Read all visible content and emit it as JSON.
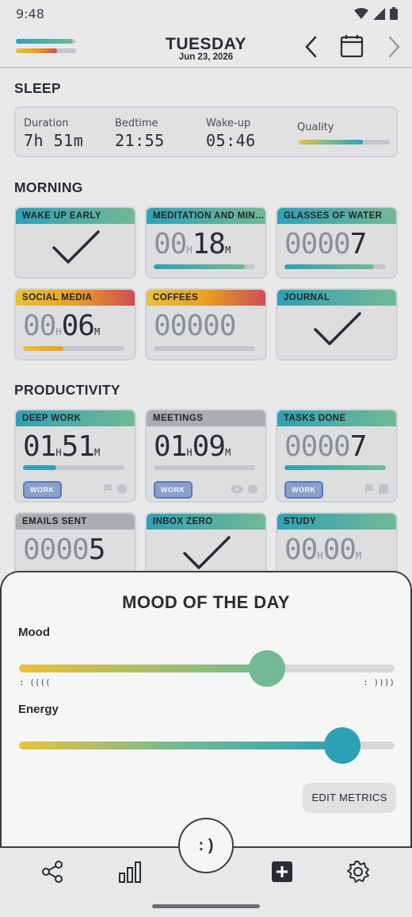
{
  "status": {
    "time": "9:48"
  },
  "header": {
    "day": "TUESDAY",
    "date": "Jun 23, 2026",
    "bar1_fill": 0.95,
    "bar2_fill": 0.68
  },
  "sleep": {
    "title": "SLEEP",
    "duration_label": "Duration",
    "duration_value": "7h 51m",
    "bedtime_label": "Bedtime",
    "bedtime_value": "21:55",
    "wakeup_label": "Wake-up",
    "wakeup_value": "05:46",
    "quality_label": "Quality",
    "quality_fill": 0.7
  },
  "morning": {
    "title": "MORNING",
    "tiles": [
      {
        "label": "WAKE UP EARLY",
        "kind": "check"
      },
      {
        "label": "MEDITATION AND MINDFULNESS",
        "hours": "00",
        "hours_unit": "H",
        "minutes": "18",
        "minutes_unit": "M",
        "fill": 0.9
      },
      {
        "label": "GLASSES OF WATER",
        "count_dim": "0000",
        "count": "7",
        "fill": 0.88
      },
      {
        "label": "SOCIAL MEDIA",
        "hours": "00",
        "hours_unit": "H",
        "minutes": "06",
        "minutes_unit": "M",
        "fill": 0.4
      },
      {
        "label": "COFFEES",
        "count_dim": "00000",
        "count": "",
        "fill": 0
      },
      {
        "label": "JOURNAL",
        "kind": "check"
      }
    ]
  },
  "productivity": {
    "title": "PRODUCTIVITY",
    "tiles": [
      {
        "label": "DEEP WORK",
        "hours": "01",
        "hours_unit": "H",
        "minutes": "51",
        "minutes_unit": "M",
        "fill": 0.33,
        "tag": "WORK"
      },
      {
        "label": "MEETINGS",
        "hours": "01",
        "hours_unit": "H",
        "minutes": "09",
        "minutes_unit": "M",
        "fill": 0,
        "tag": "WORK"
      },
      {
        "label": "TASKS DONE",
        "count_dim": "0000",
        "count": "7",
        "fill": 1.0,
        "tag": "WORK"
      },
      {
        "label": "EMAILS SENT",
        "count_dim": "0000",
        "count": "5"
      },
      {
        "label": "INBOX ZERO",
        "kind": "check"
      },
      {
        "label": "STUDY",
        "hours": "00",
        "hours_unit": "H",
        "minutes": "00",
        "minutes_unit": "M"
      }
    ]
  },
  "mood_sheet": {
    "title": "MOOD OF THE DAY",
    "mood_label": "Mood",
    "mood_value": 0.66,
    "mood_min_hint": ": ((((",
    "mood_max_hint": ": ))))",
    "energy_label": "Energy",
    "energy_value": 0.86,
    "edit_label": "EDIT METRICS"
  },
  "nav": {
    "mood_button": ": )",
    "items": [
      "share-icon",
      "bar-chart-icon",
      "add-square-icon",
      "settings-icon"
    ]
  },
  "colors": {
    "teal": "#2fa1b4",
    "green": "#72b995",
    "yellow": "#e9c13a",
    "orange": "#e8a020",
    "red": "#cc4d55",
    "gray_head": "#a9aeb2"
  }
}
